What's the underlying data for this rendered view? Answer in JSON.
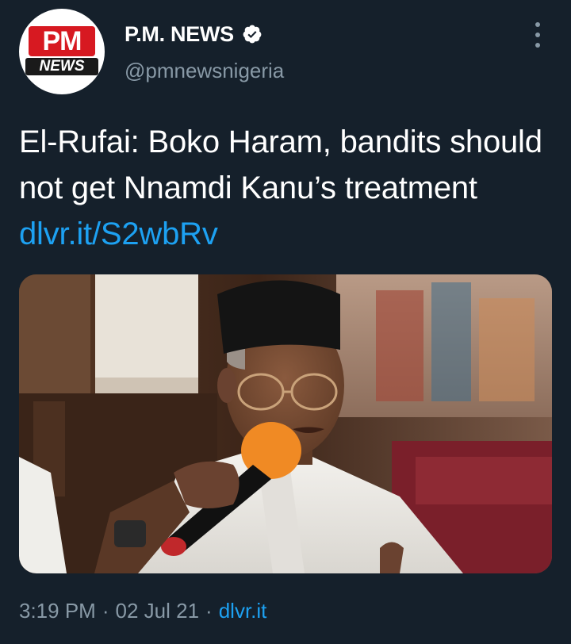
{
  "account": {
    "display_name": "P.M. NEWS",
    "handle": "@pmnewsnigeria",
    "verified": true,
    "avatar_text_top": "PM",
    "avatar_text_bottom": "NEWS"
  },
  "tweet": {
    "text": "El-Rufai: Boko Haram, bandits should not get Nnamdi Kanu’s treatment ",
    "link_text": "dlvr.it/S2wbRv"
  },
  "media": {
    "alt": "Photo of a man in a black cap and glasses speaking into an orange microphone"
  },
  "meta": {
    "time": "3:19 PM",
    "separator": "·",
    "date": "02 Jul 21",
    "source": "dlvr.it"
  },
  "colors": {
    "background": "#15202b",
    "text_primary": "#ffffff",
    "text_secondary": "#8899a6",
    "link": "#1da1f2",
    "brand_red": "#d71921"
  },
  "icons": {
    "verified": "verified-badge-icon",
    "more": "more-vertical-icon"
  }
}
